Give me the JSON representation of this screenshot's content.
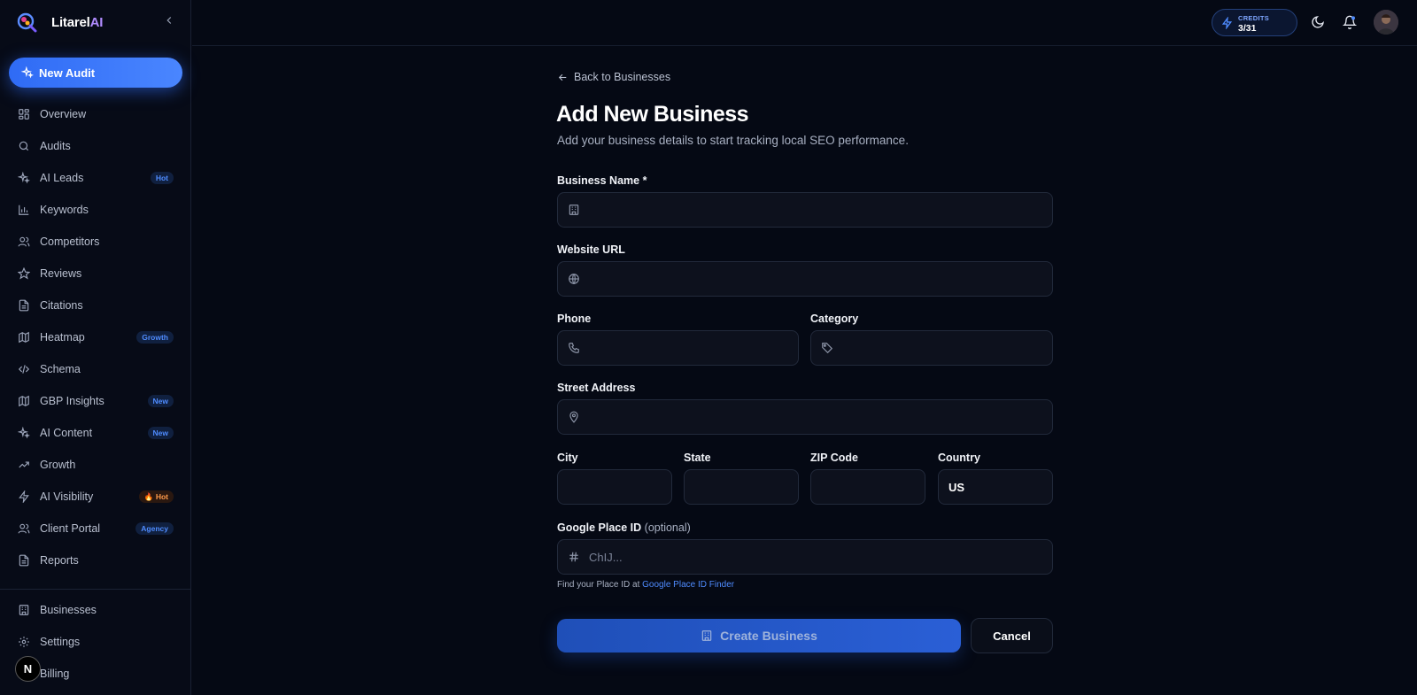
{
  "brand": {
    "name_main": "Litarel",
    "name_accent": "AI"
  },
  "sidebar": {
    "new_audit_label": "New Audit",
    "items": [
      {
        "label": "Overview",
        "icon": "grid-icon",
        "badge": ""
      },
      {
        "label": "Audits",
        "icon": "search-icon",
        "badge": ""
      },
      {
        "label": "AI Leads",
        "icon": "sparkles-icon",
        "badge": "Hot"
      },
      {
        "label": "Keywords",
        "icon": "bar-chart-icon",
        "badge": ""
      },
      {
        "label": "Competitors",
        "icon": "users-icon",
        "badge": ""
      },
      {
        "label": "Reviews",
        "icon": "star-icon",
        "badge": ""
      },
      {
        "label": "Citations",
        "icon": "file-icon",
        "badge": ""
      },
      {
        "label": "Heatmap",
        "icon": "map-icon",
        "badge": "Growth"
      },
      {
        "label": "Schema",
        "icon": "code-icon",
        "badge": ""
      },
      {
        "label": "GBP Insights",
        "icon": "map-icon",
        "badge": "New"
      },
      {
        "label": "AI Content",
        "icon": "sparkles-icon",
        "badge": "New"
      },
      {
        "label": "Growth",
        "icon": "trending-up-icon",
        "badge": ""
      },
      {
        "label": "AI Visibility",
        "icon": "zap-icon",
        "badge": "🔥 Hot"
      },
      {
        "label": "Client Portal",
        "icon": "users-icon",
        "badge": "Agency"
      },
      {
        "label": "Reports",
        "icon": "file-icon",
        "badge": ""
      }
    ],
    "bottom_items": [
      {
        "label": "Businesses",
        "icon": "building-icon"
      },
      {
        "label": "Settings",
        "icon": "gear-icon"
      },
      {
        "label": "Billing",
        "icon": "card-icon"
      }
    ],
    "n_badge": "N"
  },
  "topbar": {
    "credits_label": "CREDITS",
    "credits_value": "3/31"
  },
  "form": {
    "back_label": "Back to Businesses",
    "title": "Add New Business",
    "subtitle": "Add your business details to start tracking local SEO performance.",
    "business_name_label": "Business Name *",
    "website_label": "Website URL",
    "phone_label": "Phone",
    "category_label": "Category",
    "street_label": "Street Address",
    "city_label": "City",
    "state_label": "State",
    "zip_label": "ZIP Code",
    "country_label": "Country",
    "country_value": "US",
    "place_id_label": "Google Place ID",
    "place_id_optional": "(optional)",
    "place_id_placeholder": "ChIJ...",
    "help_text": "Find your Place ID at",
    "help_link": "Google Place ID Finder",
    "create_label": "Create Business",
    "cancel_label": "Cancel"
  },
  "colors": {
    "accent": "#2f6bf5",
    "background": "#050914",
    "badge_text": "#4f8cff"
  }
}
